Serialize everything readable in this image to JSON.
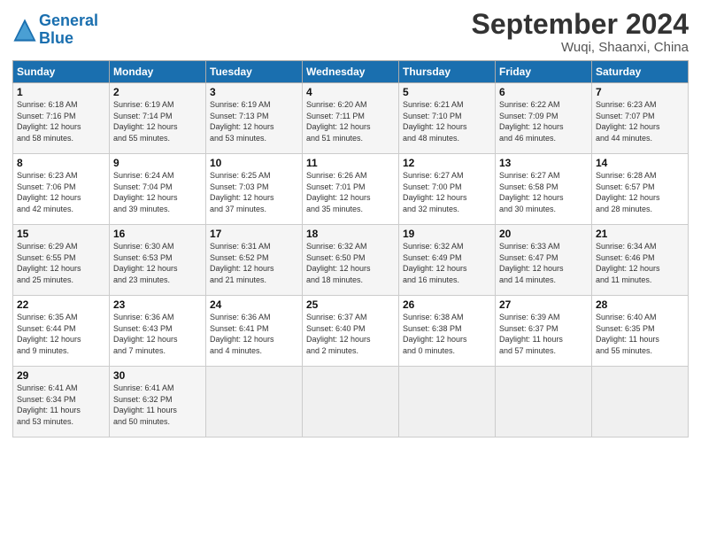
{
  "header": {
    "logo_line1": "General",
    "logo_line2": "Blue",
    "month": "September 2024",
    "location": "Wuqi, Shaanxi, China"
  },
  "weekdays": [
    "Sunday",
    "Monday",
    "Tuesday",
    "Wednesday",
    "Thursday",
    "Friday",
    "Saturday"
  ],
  "weeks": [
    [
      {
        "day": "1",
        "info": "Sunrise: 6:18 AM\nSunset: 7:16 PM\nDaylight: 12 hours\nand 58 minutes."
      },
      {
        "day": "2",
        "info": "Sunrise: 6:19 AM\nSunset: 7:14 PM\nDaylight: 12 hours\nand 55 minutes."
      },
      {
        "day": "3",
        "info": "Sunrise: 6:19 AM\nSunset: 7:13 PM\nDaylight: 12 hours\nand 53 minutes."
      },
      {
        "day": "4",
        "info": "Sunrise: 6:20 AM\nSunset: 7:11 PM\nDaylight: 12 hours\nand 51 minutes."
      },
      {
        "day": "5",
        "info": "Sunrise: 6:21 AM\nSunset: 7:10 PM\nDaylight: 12 hours\nand 48 minutes."
      },
      {
        "day": "6",
        "info": "Sunrise: 6:22 AM\nSunset: 7:09 PM\nDaylight: 12 hours\nand 46 minutes."
      },
      {
        "day": "7",
        "info": "Sunrise: 6:23 AM\nSunset: 7:07 PM\nDaylight: 12 hours\nand 44 minutes."
      }
    ],
    [
      {
        "day": "8",
        "info": "Sunrise: 6:23 AM\nSunset: 7:06 PM\nDaylight: 12 hours\nand 42 minutes."
      },
      {
        "day": "9",
        "info": "Sunrise: 6:24 AM\nSunset: 7:04 PM\nDaylight: 12 hours\nand 39 minutes."
      },
      {
        "day": "10",
        "info": "Sunrise: 6:25 AM\nSunset: 7:03 PM\nDaylight: 12 hours\nand 37 minutes."
      },
      {
        "day": "11",
        "info": "Sunrise: 6:26 AM\nSunset: 7:01 PM\nDaylight: 12 hours\nand 35 minutes."
      },
      {
        "day": "12",
        "info": "Sunrise: 6:27 AM\nSunset: 7:00 PM\nDaylight: 12 hours\nand 32 minutes."
      },
      {
        "day": "13",
        "info": "Sunrise: 6:27 AM\nSunset: 6:58 PM\nDaylight: 12 hours\nand 30 minutes."
      },
      {
        "day": "14",
        "info": "Sunrise: 6:28 AM\nSunset: 6:57 PM\nDaylight: 12 hours\nand 28 minutes."
      }
    ],
    [
      {
        "day": "15",
        "info": "Sunrise: 6:29 AM\nSunset: 6:55 PM\nDaylight: 12 hours\nand 25 minutes."
      },
      {
        "day": "16",
        "info": "Sunrise: 6:30 AM\nSunset: 6:53 PM\nDaylight: 12 hours\nand 23 minutes."
      },
      {
        "day": "17",
        "info": "Sunrise: 6:31 AM\nSunset: 6:52 PM\nDaylight: 12 hours\nand 21 minutes."
      },
      {
        "day": "18",
        "info": "Sunrise: 6:32 AM\nSunset: 6:50 PM\nDaylight: 12 hours\nand 18 minutes."
      },
      {
        "day": "19",
        "info": "Sunrise: 6:32 AM\nSunset: 6:49 PM\nDaylight: 12 hours\nand 16 minutes."
      },
      {
        "day": "20",
        "info": "Sunrise: 6:33 AM\nSunset: 6:47 PM\nDaylight: 12 hours\nand 14 minutes."
      },
      {
        "day": "21",
        "info": "Sunrise: 6:34 AM\nSunset: 6:46 PM\nDaylight: 12 hours\nand 11 minutes."
      }
    ],
    [
      {
        "day": "22",
        "info": "Sunrise: 6:35 AM\nSunset: 6:44 PM\nDaylight: 12 hours\nand 9 minutes."
      },
      {
        "day": "23",
        "info": "Sunrise: 6:36 AM\nSunset: 6:43 PM\nDaylight: 12 hours\nand 7 minutes."
      },
      {
        "day": "24",
        "info": "Sunrise: 6:36 AM\nSunset: 6:41 PM\nDaylight: 12 hours\nand 4 minutes."
      },
      {
        "day": "25",
        "info": "Sunrise: 6:37 AM\nSunset: 6:40 PM\nDaylight: 12 hours\nand 2 minutes."
      },
      {
        "day": "26",
        "info": "Sunrise: 6:38 AM\nSunset: 6:38 PM\nDaylight: 12 hours\nand 0 minutes."
      },
      {
        "day": "27",
        "info": "Sunrise: 6:39 AM\nSunset: 6:37 PM\nDaylight: 11 hours\nand 57 minutes."
      },
      {
        "day": "28",
        "info": "Sunrise: 6:40 AM\nSunset: 6:35 PM\nDaylight: 11 hours\nand 55 minutes."
      }
    ],
    [
      {
        "day": "29",
        "info": "Sunrise: 6:41 AM\nSunset: 6:34 PM\nDaylight: 11 hours\nand 53 minutes."
      },
      {
        "day": "30",
        "info": "Sunrise: 6:41 AM\nSunset: 6:32 PM\nDaylight: 11 hours\nand 50 minutes."
      },
      {
        "day": "",
        "info": ""
      },
      {
        "day": "",
        "info": ""
      },
      {
        "day": "",
        "info": ""
      },
      {
        "day": "",
        "info": ""
      },
      {
        "day": "",
        "info": ""
      }
    ]
  ]
}
